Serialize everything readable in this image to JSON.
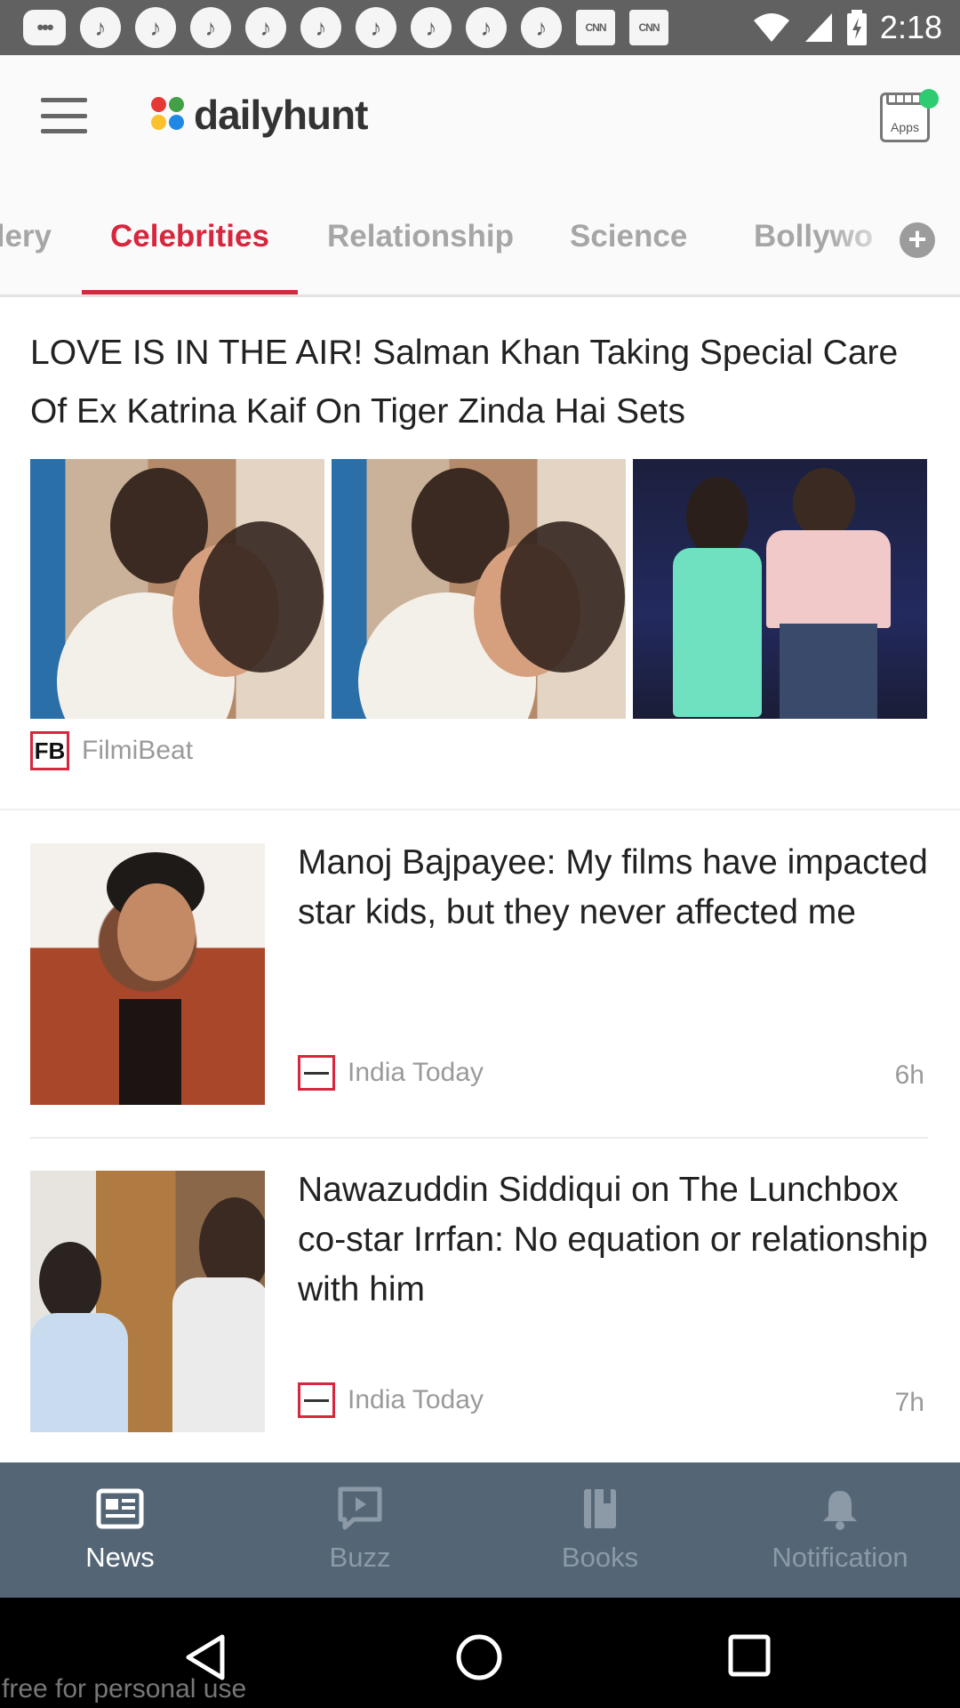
{
  "status_bar": {
    "time": "2:18",
    "notification_icons": [
      "message-icon",
      "music-icon",
      "music-icon",
      "music-icon",
      "music-icon",
      "music-icon",
      "music-icon",
      "music-icon",
      "music-icon",
      "music-icon",
      "cnn-icon",
      "cnn-icon"
    ],
    "cnn_label": "CNN",
    "system_icons": [
      "wifi-icon",
      "signal-icon",
      "battery-charging-icon"
    ]
  },
  "app_bar": {
    "logo_text": "dailyhunt",
    "apps_label": "Apps",
    "colors": {
      "dot_green": "#2ecc71",
      "logo_red": "#e53935",
      "logo_yellow": "#fbc02d",
      "logo_blue": "#1e88e5",
      "logo_green": "#43a047"
    }
  },
  "tabs": {
    "items": [
      {
        "label": "llery"
      },
      {
        "label": "Celebrities",
        "active": true
      },
      {
        "label": "Relationship"
      },
      {
        "label": "Science"
      },
      {
        "label": "Bollywo"
      }
    ],
    "accent_color": "#d7263d"
  },
  "feed": {
    "featured": {
      "title": "LOVE IS IN THE AIR! Salman Khan Taking Special Care Of Ex Katrina Kaif On Tiger Zinda Hai Sets",
      "source_logo": "FB",
      "source": "FilmiBeat"
    },
    "items": [
      {
        "title": "Manoj Bajpayee: My films have impacted star kids, but they never affected me",
        "source": "India Today",
        "age": "6h"
      },
      {
        "title": "Nawazuddin Siddiqui on The Lunchbox co-star Irrfan: No equation or relationship with him",
        "source": "India Today",
        "age": "7h"
      }
    ]
  },
  "bottom_nav": {
    "items": [
      {
        "label": "News",
        "icon": "newspaper-icon",
        "active": true
      },
      {
        "label": "Buzz",
        "icon": "play-bubble-icon"
      },
      {
        "label": "Books",
        "icon": "book-icon"
      },
      {
        "label": "Notification",
        "icon": "bell-icon"
      }
    ],
    "background": "#546676"
  },
  "watermark": "free for personal use"
}
